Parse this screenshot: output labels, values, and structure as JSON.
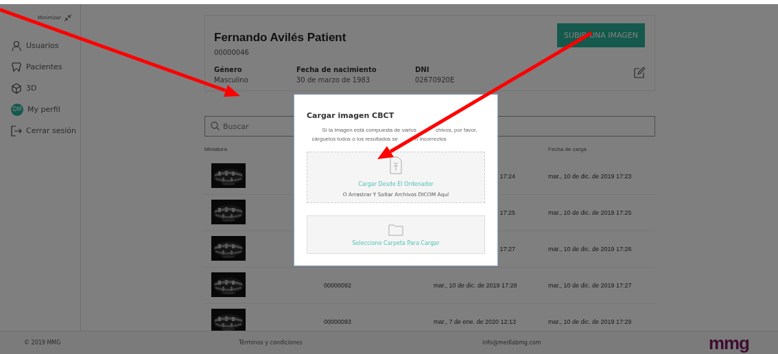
{
  "sidebar": {
    "minimize": {
      "label": "Minimizar"
    },
    "items": [
      {
        "kind": "user",
        "label": "Usuarios"
      },
      {
        "kind": "tooth",
        "label": "Pacientes"
      },
      {
        "kind": "cube",
        "label": "3D"
      },
      {
        "kind": "avatar",
        "initials": "DM",
        "label": "My perfil"
      },
      {
        "kind": "logout",
        "label": "Cerrar sesión"
      }
    ]
  },
  "patient": {
    "name": "Fernando Avilés Patient",
    "id": "00000046",
    "upload_button": "SUBIR UNA IMAGEN",
    "fields": [
      {
        "label": "Género",
        "value": "Masculino"
      },
      {
        "label": "Fecha de nacimiento",
        "value": "30 de marzo de 1983"
      },
      {
        "label": "DNI",
        "value": "02670920E"
      }
    ]
  },
  "search": {
    "placeholder": "Buscar"
  },
  "table": {
    "header": {
      "thumbnail": "Miniatura",
      "upload_date": "Fecha de carga"
    },
    "rows": [
      {
        "date": "17:24",
        "upload_date": "mar., 10 de dic. de 2019 17:23"
      },
      {
        "date": "17:25",
        "upload_date": "mar., 10 de dic. de 2019 17:25"
      },
      {
        "date": "17:27",
        "upload_date": "mar., 10 de dic. de 2019 17:26"
      },
      {
        "number": "00000092",
        "date": "mar., 10 de dic. de 2019 17:28",
        "upload_date": "mar., 10 de dic. de 2019 17:27"
      },
      {
        "number": "00000093",
        "date": "mar., 7 de ene. de 2020 12:13",
        "upload_date": "mar., 10 de dic. de 2019 17:29"
      }
    ]
  },
  "modal": {
    "title": "Cargar imagen CBCT",
    "message": [
      [
        "Si la imagen está compuesta de varios",
        "chivos, por favor,"
      ],
      [
        "cárguelos todos o los resultados se",
        "n incorrectos"
      ]
    ],
    "dropzone": {
      "action": "Cargar Desde El Ordenador",
      "hint": "O Arrastrar Y Soltar Archivos DICOM Aquí"
    },
    "folder_button": "Seleccione Carpeta Para Cargar"
  },
  "footer": {
    "copyright": "© 2019 MMG",
    "terms": "Términos y condiciones",
    "email": "info@medlabmg.com",
    "logo": "mmg"
  }
}
